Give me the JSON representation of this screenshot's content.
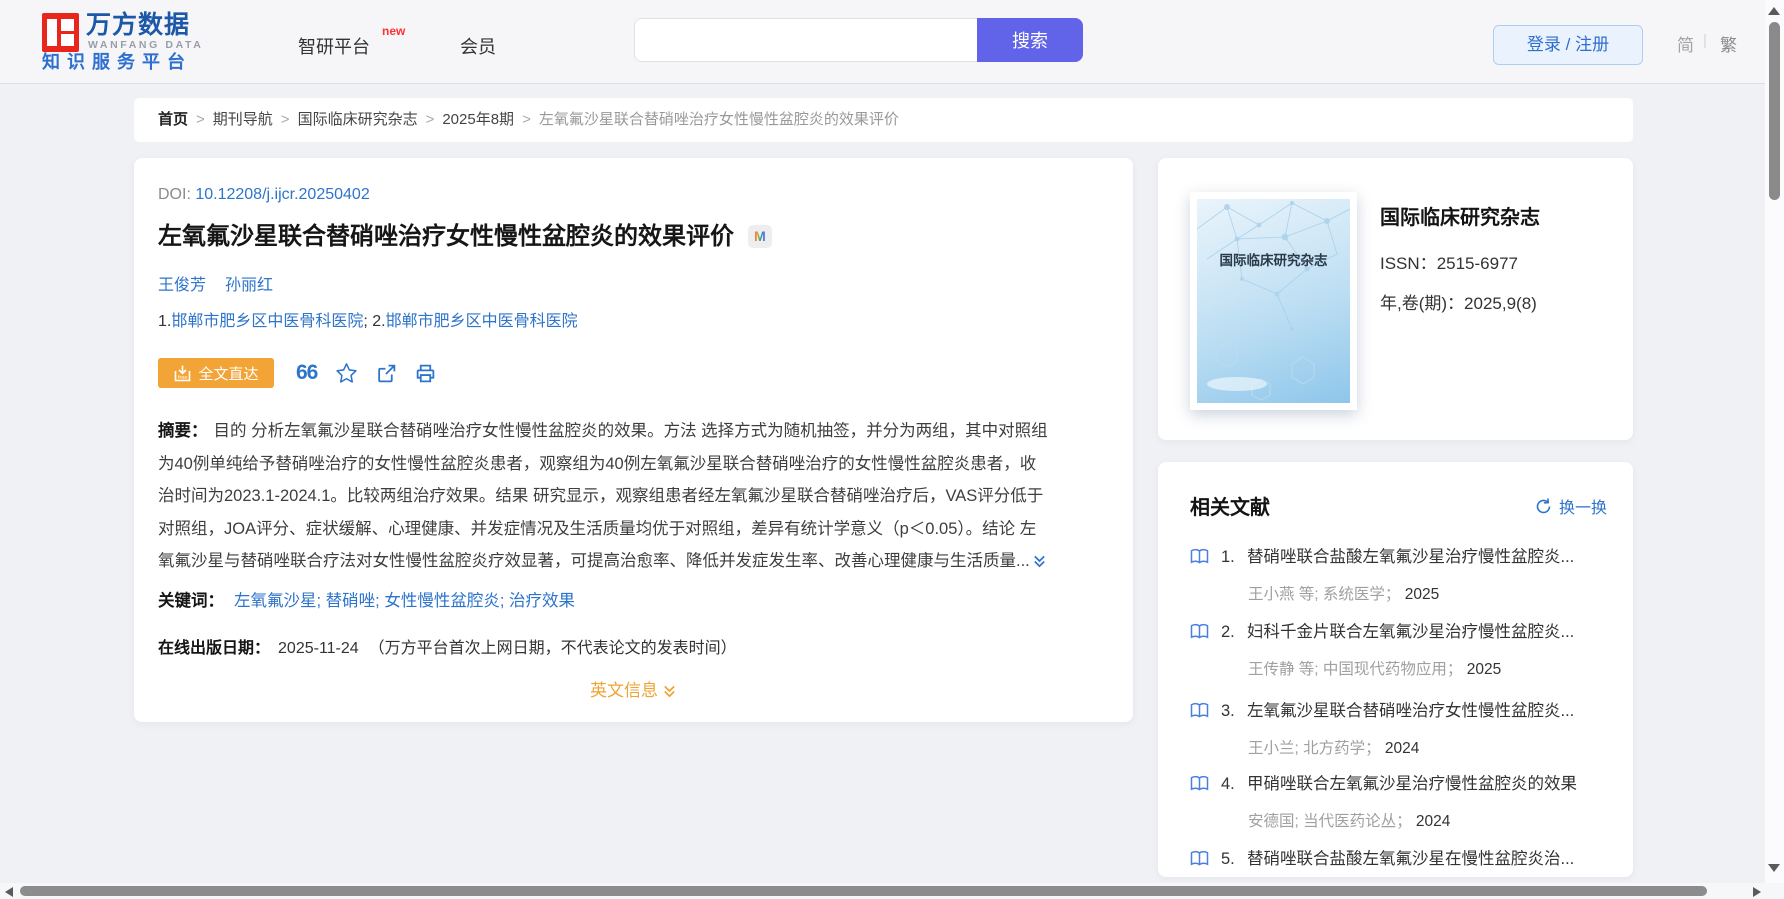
{
  "header": {
    "logo": {
      "cn": "万方数据",
      "en": "WANFANG DATA",
      "subtitle": "知识服务平台"
    },
    "nav": [
      {
        "label": "智研平台",
        "badge": "new"
      },
      {
        "label": "会员",
        "badge": ""
      }
    ],
    "search": {
      "value": "",
      "button": "搜索"
    },
    "login_label": "登录 / 注册",
    "lang": {
      "simplified": "简",
      "traditional": "繁"
    }
  },
  "breadcrumb": [
    "首页",
    "期刊导航",
    "国际临床研究杂志",
    "2025年8期",
    "左氧氟沙星联合替硝唑治疗女性慢性盆腔炎的效果评价"
  ],
  "article": {
    "doi_label": "DOI:",
    "doi": "10.12208/j.ijcr.20250402",
    "title": "左氧氟沙星联合替硝唑治疗女性慢性盆腔炎的效果评价",
    "badge": "M",
    "authors": [
      "王俊芳",
      "孙丽红"
    ],
    "affiliations": [
      {
        "num": "1.",
        "name": "邯郸市肥乡区中医骨科医院",
        "sep": "; "
      },
      {
        "num": "2.",
        "name": "邯郸市肥乡区中医骨科医院",
        "sep": ""
      }
    ],
    "fulltext_button": "全文直达",
    "abstract_label": "摘要：",
    "abstract_lines": [
      "目的 分析左氧氟沙星联合替硝唑治疗女性慢性盆腔炎的效果。方法 选择方式为随机抽签，并分为两组，其中对照组",
      "为40例单纯给予替硝唑治疗的女性慢性盆腔炎患者，观察组为40例左氧氟沙星联合替硝唑治疗的女性慢性盆腔炎患者，收",
      "治时间为2023.1-2024.1。比较两组治疗效果。结果 研究显示，观察组患者经左氧氟沙星联合替硝唑治疗后，VAS评分低于",
      "对照组，JOA评分、症状缓解、心理健康、并发症情况及生活质量均优于对照组，差异有统计学意义（p＜0.05）。结论 左",
      "氧氟沙星与替硝唑联合疗法对女性慢性盆腔炎疗效显著，可提高治愈率、降低并发症发生率、改善心理健康与生活质量..."
    ],
    "keywords_label": "关键词：",
    "keywords": [
      "左氧氟沙星",
      "替硝唑",
      "女性慢性盆腔炎",
      "治疗效果"
    ],
    "pubdate_label": "在线出版日期：",
    "pubdate": "2025-11-24",
    "pubdate_note": "（万方平台首次上网日期，不代表论文的发表时间）",
    "english_info": "英文信息"
  },
  "journal": {
    "cover_text": "国际临床研究杂志",
    "name": "国际临床研究杂志",
    "issn_label": "ISSN：",
    "issn": "2515-6977",
    "volume_label": "年,卷(期)：",
    "volume": "2025,9(8)"
  },
  "related": {
    "title": "相关文献",
    "refresh_label": "换一换",
    "items": [
      {
        "num": "1.",
        "title": "替硝唑联合盐酸左氧氟沙星治疗慢性盆腔炎...",
        "meta": "王小燕  等;  系统医学；",
        "year": "2025"
      },
      {
        "num": "2.",
        "title": "妇科千金片联合左氧氟沙星治疗慢性盆腔炎...",
        "meta": "王传静  等;  中国现代药物应用；",
        "year": "2025"
      },
      {
        "num": "3.",
        "title": "左氧氟沙星联合替硝唑治疗女性慢性盆腔炎...",
        "meta": "王小兰; 北方药学；",
        "year": "2024"
      },
      {
        "num": "4.",
        "title": "甲硝唑联合左氧氟沙星治疗慢性盆腔炎的效果",
        "meta": "安德国; 当代医药论丛；",
        "year": "2024"
      },
      {
        "num": "5.",
        "title": "替硝唑联合盐酸左氧氟沙星在慢性盆腔炎治...",
        "meta": "",
        "year": ""
      }
    ]
  },
  "colors": {
    "link_blue": "#2d74cb",
    "accent_indigo": "#6163e8",
    "accent_orange": "#f2a436",
    "logo_red": "#e8261c",
    "logo_blue": "#1c57a8"
  }
}
